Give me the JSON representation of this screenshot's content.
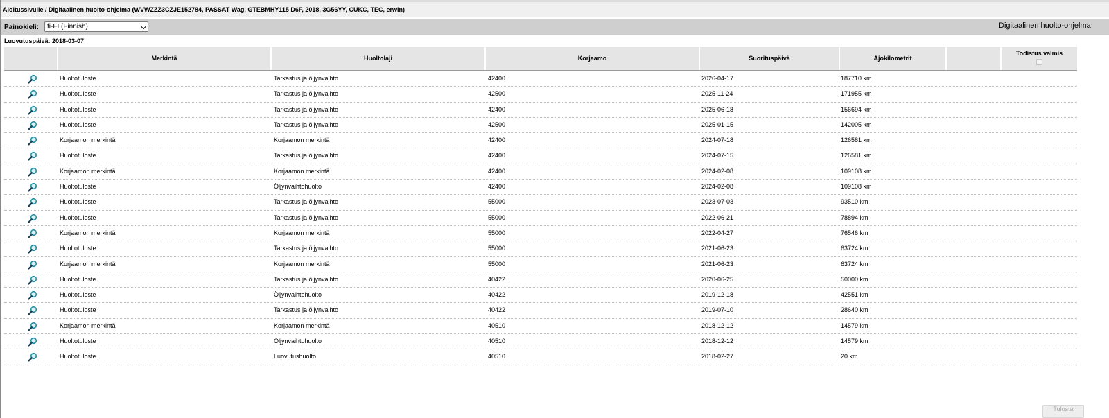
{
  "breadcrumb": "Aloitussivulle / Digitaalinen huolto-ohjelma (WVWZZZ3CZJE152784, PASSAT Wag. GTEBMHY115 D6F, 2018, 3G56YY, CUKC, TEC, erwin)",
  "language": {
    "label": "Painokieli:",
    "selected": "fi-FI (Finnish)"
  },
  "program_title": "Digitaalinen huolto-ohjelma",
  "delivery_date": "Luovutuspäivä: 2018-03-07",
  "columns": {
    "merkinta": "Merkintä",
    "huoltolaji": "Huoltolaji",
    "korjaamo": "Korjaamo",
    "suorituspaiva": "Suorituspäivä",
    "ajokilometrit": "Ajokilometrit",
    "todistus": "Todistus valmis"
  },
  "rows": [
    {
      "merkinta": "Huoltotuloste",
      "huoltolaji": "Tarkastus ja öljynvaihto",
      "korjaamo": "42400",
      "paiva": "2026-04-17",
      "km": "187710 km"
    },
    {
      "merkinta": "Huoltotuloste",
      "huoltolaji": "Tarkastus ja öljynvaihto",
      "korjaamo": "42500",
      "paiva": "2025-11-24",
      "km": "171955 km"
    },
    {
      "merkinta": "Huoltotuloste",
      "huoltolaji": "Tarkastus ja öljynvaihto",
      "korjaamo": "42400",
      "paiva": "2025-06-18",
      "km": "156694 km"
    },
    {
      "merkinta": "Huoltotuloste",
      "huoltolaji": "Tarkastus ja öljynvaihto",
      "korjaamo": "42500",
      "paiva": "2025-01-15",
      "km": "142005 km"
    },
    {
      "merkinta": "Korjaamon merkintä",
      "huoltolaji": "Korjaamon merkintä",
      "korjaamo": "42400",
      "paiva": "2024-07-18",
      "km": "126581 km"
    },
    {
      "merkinta": "Huoltotuloste",
      "huoltolaji": "Tarkastus ja öljynvaihto",
      "korjaamo": "42400",
      "paiva": "2024-07-15",
      "km": "126581 km"
    },
    {
      "merkinta": "Korjaamon merkintä",
      "huoltolaji": "Korjaamon merkintä",
      "korjaamo": "42400",
      "paiva": "2024-02-08",
      "km": "109108 km"
    },
    {
      "merkinta": "Huoltotuloste",
      "huoltolaji": "Öljynvaihtohuolto",
      "korjaamo": "42400",
      "paiva": "2024-02-08",
      "km": "109108 km"
    },
    {
      "merkinta": "Huoltotuloste",
      "huoltolaji": "Tarkastus ja öljynvaihto",
      "korjaamo": "55000",
      "paiva": "2023-07-03",
      "km": "93510 km"
    },
    {
      "merkinta": "Huoltotuloste",
      "huoltolaji": "Tarkastus ja öljynvaihto",
      "korjaamo": "55000",
      "paiva": "2022-06-21",
      "km": "78894 km"
    },
    {
      "merkinta": "Korjaamon merkintä",
      "huoltolaji": "Korjaamon merkintä",
      "korjaamo": "55000",
      "paiva": "2022-04-27",
      "km": "76546 km"
    },
    {
      "merkinta": "Huoltotuloste",
      "huoltolaji": "Tarkastus ja öljynvaihto",
      "korjaamo": "55000",
      "paiva": "2021-06-23",
      "km": "63724 km"
    },
    {
      "merkinta": "Korjaamon merkintä",
      "huoltolaji": "Korjaamon merkintä",
      "korjaamo": "55000",
      "paiva": "2021-06-23",
      "km": "63724 km"
    },
    {
      "merkinta": "Huoltotuloste",
      "huoltolaji": "Tarkastus ja öljynvaihto",
      "korjaamo": "40422",
      "paiva": "2020-06-25",
      "km": "50000 km"
    },
    {
      "merkinta": "Huoltotuloste",
      "huoltolaji": "Öljynvaihtohuolto",
      "korjaamo": "40422",
      "paiva": "2019-12-18",
      "km": "42551 km"
    },
    {
      "merkinta": "Huoltotuloste",
      "huoltolaji": "Tarkastus ja öljynvaihto",
      "korjaamo": "40422",
      "paiva": "2019-07-10",
      "km": "28640 km"
    },
    {
      "merkinta": "Korjaamon merkintä",
      "huoltolaji": "Korjaamon merkintä",
      "korjaamo": "40510",
      "paiva": "2018-12-12",
      "km": "14579 km"
    },
    {
      "merkinta": "Huoltotuloste",
      "huoltolaji": "Öljynvaihtohuolto",
      "korjaamo": "40510",
      "paiva": "2018-12-12",
      "km": "14579 km"
    },
    {
      "merkinta": "Huoltotuloste",
      "huoltolaji": "Luovutushuolto",
      "korjaamo": "40510",
      "paiva": "2018-02-27",
      "km": "20 km"
    }
  ],
  "footer_button": "Tulosta",
  "icons": {
    "row_action": "magnifier-icon",
    "select_arrow": "chevron-down-icon"
  },
  "colors": {
    "header_bg": "#e5e5e5",
    "toolbar_bg": "#cfcfcf",
    "magnifier_lens": "#1a8fa8"
  }
}
